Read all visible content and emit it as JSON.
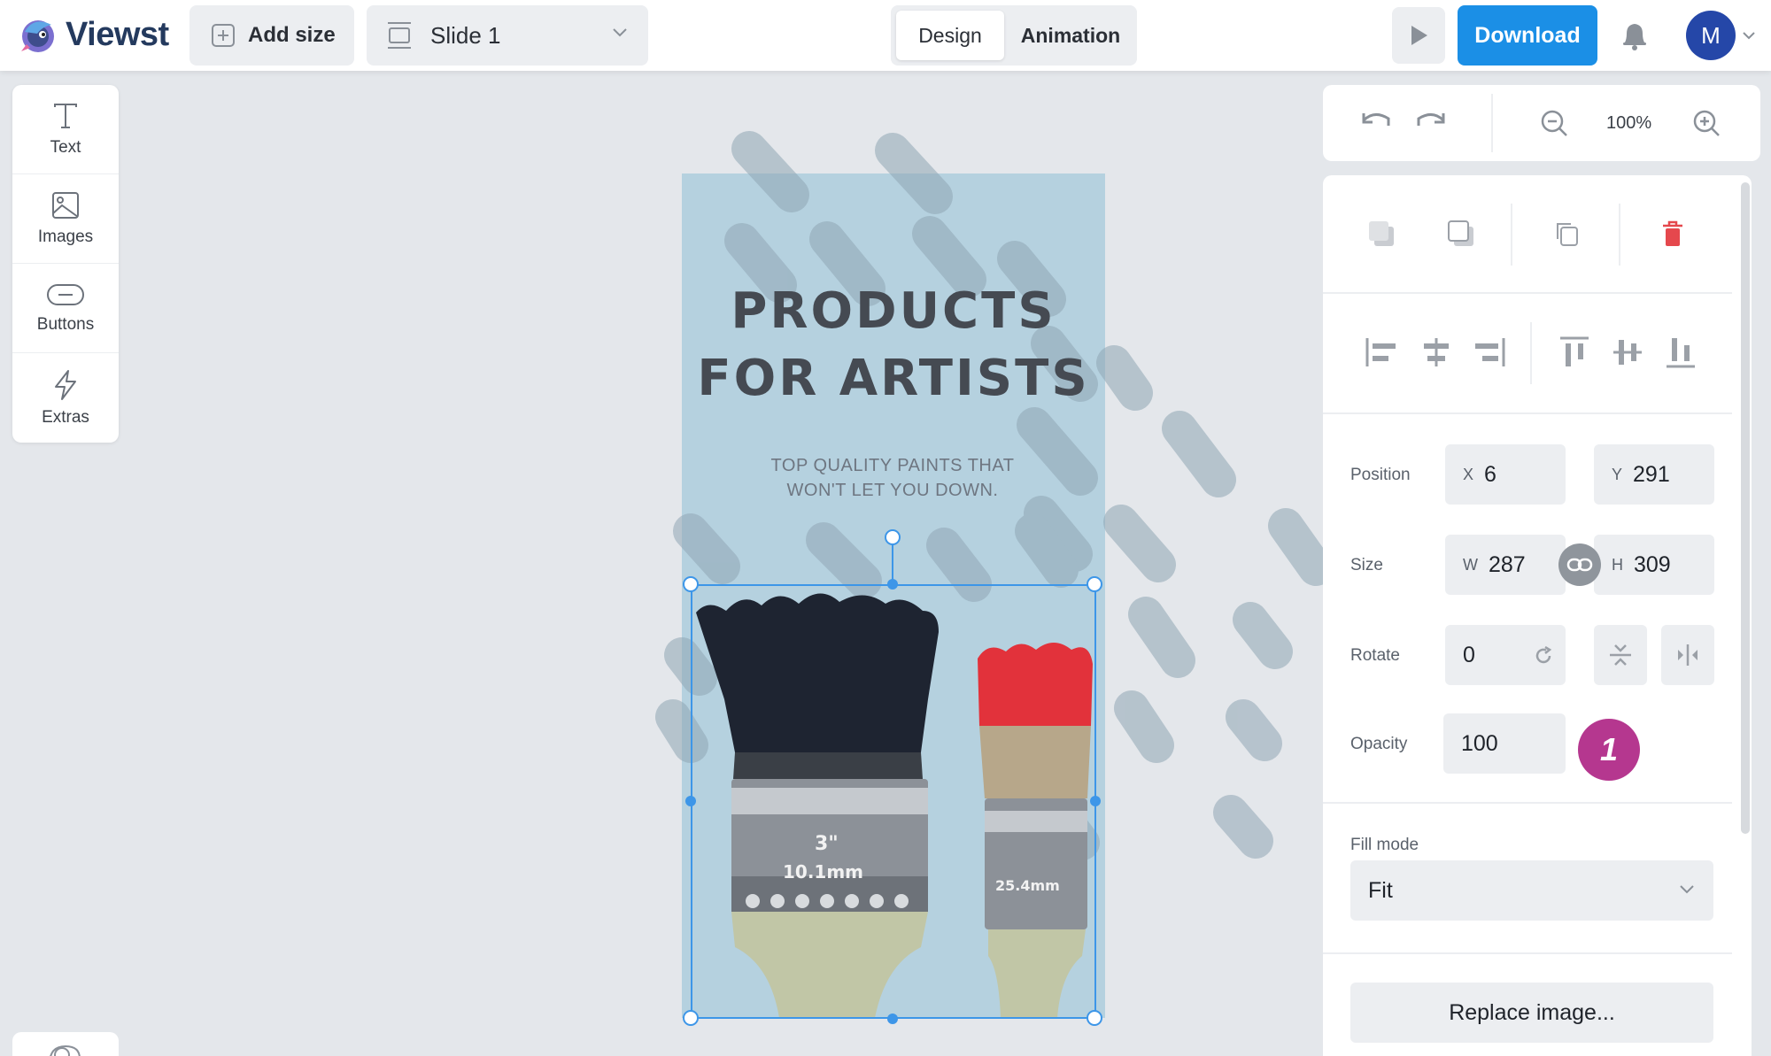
{
  "app": {
    "name": "Viewst"
  },
  "toolbar": {
    "add_size_label": "Add size",
    "slide_label": "Slide 1",
    "tabs": [
      {
        "label": "Design",
        "active": true
      },
      {
        "label": "Animation",
        "active": false
      }
    ],
    "download_label": "Download",
    "avatar_initial": "M"
  },
  "tools": [
    {
      "label": "Text",
      "icon": "text-icon"
    },
    {
      "label": "Images",
      "icon": "image-icon"
    },
    {
      "label": "Buttons",
      "icon": "button-icon"
    },
    {
      "label": "Extras",
      "icon": "lightning-icon"
    }
  ],
  "canvas": {
    "headline_line1": "PRODUCTS",
    "headline_line2": "FOR ARTISTS",
    "subline_line1": "TOP QUALITY PAINTS THAT",
    "subline_line2": "WON'T LET YOU DOWN.",
    "brush_large_label_1": "3\"",
    "brush_large_label_2": "10.1mm",
    "brush_small_label": "25.4mm"
  },
  "zoom": {
    "value": "100%"
  },
  "properties": {
    "position_label": "Position",
    "x_prefix": "X",
    "x_value": "6",
    "y_prefix": "Y",
    "y_value": "291",
    "size_label": "Size",
    "w_prefix": "W",
    "w_value": "287",
    "h_prefix": "H",
    "h_value": "309",
    "rotate_label": "Rotate",
    "rotate_value": "0",
    "opacity_label": "Opacity",
    "opacity_value": "100",
    "badge_number": "1",
    "fill_mode_label": "Fill mode",
    "fill_mode_value": "Fit",
    "replace_label": "Replace image..."
  },
  "colors": {
    "accent": "#1b8fe6",
    "artboard_bg": "#b5d1df",
    "selection": "#3d96e8",
    "delete": "#e5484d",
    "badge": "#b5378f"
  }
}
